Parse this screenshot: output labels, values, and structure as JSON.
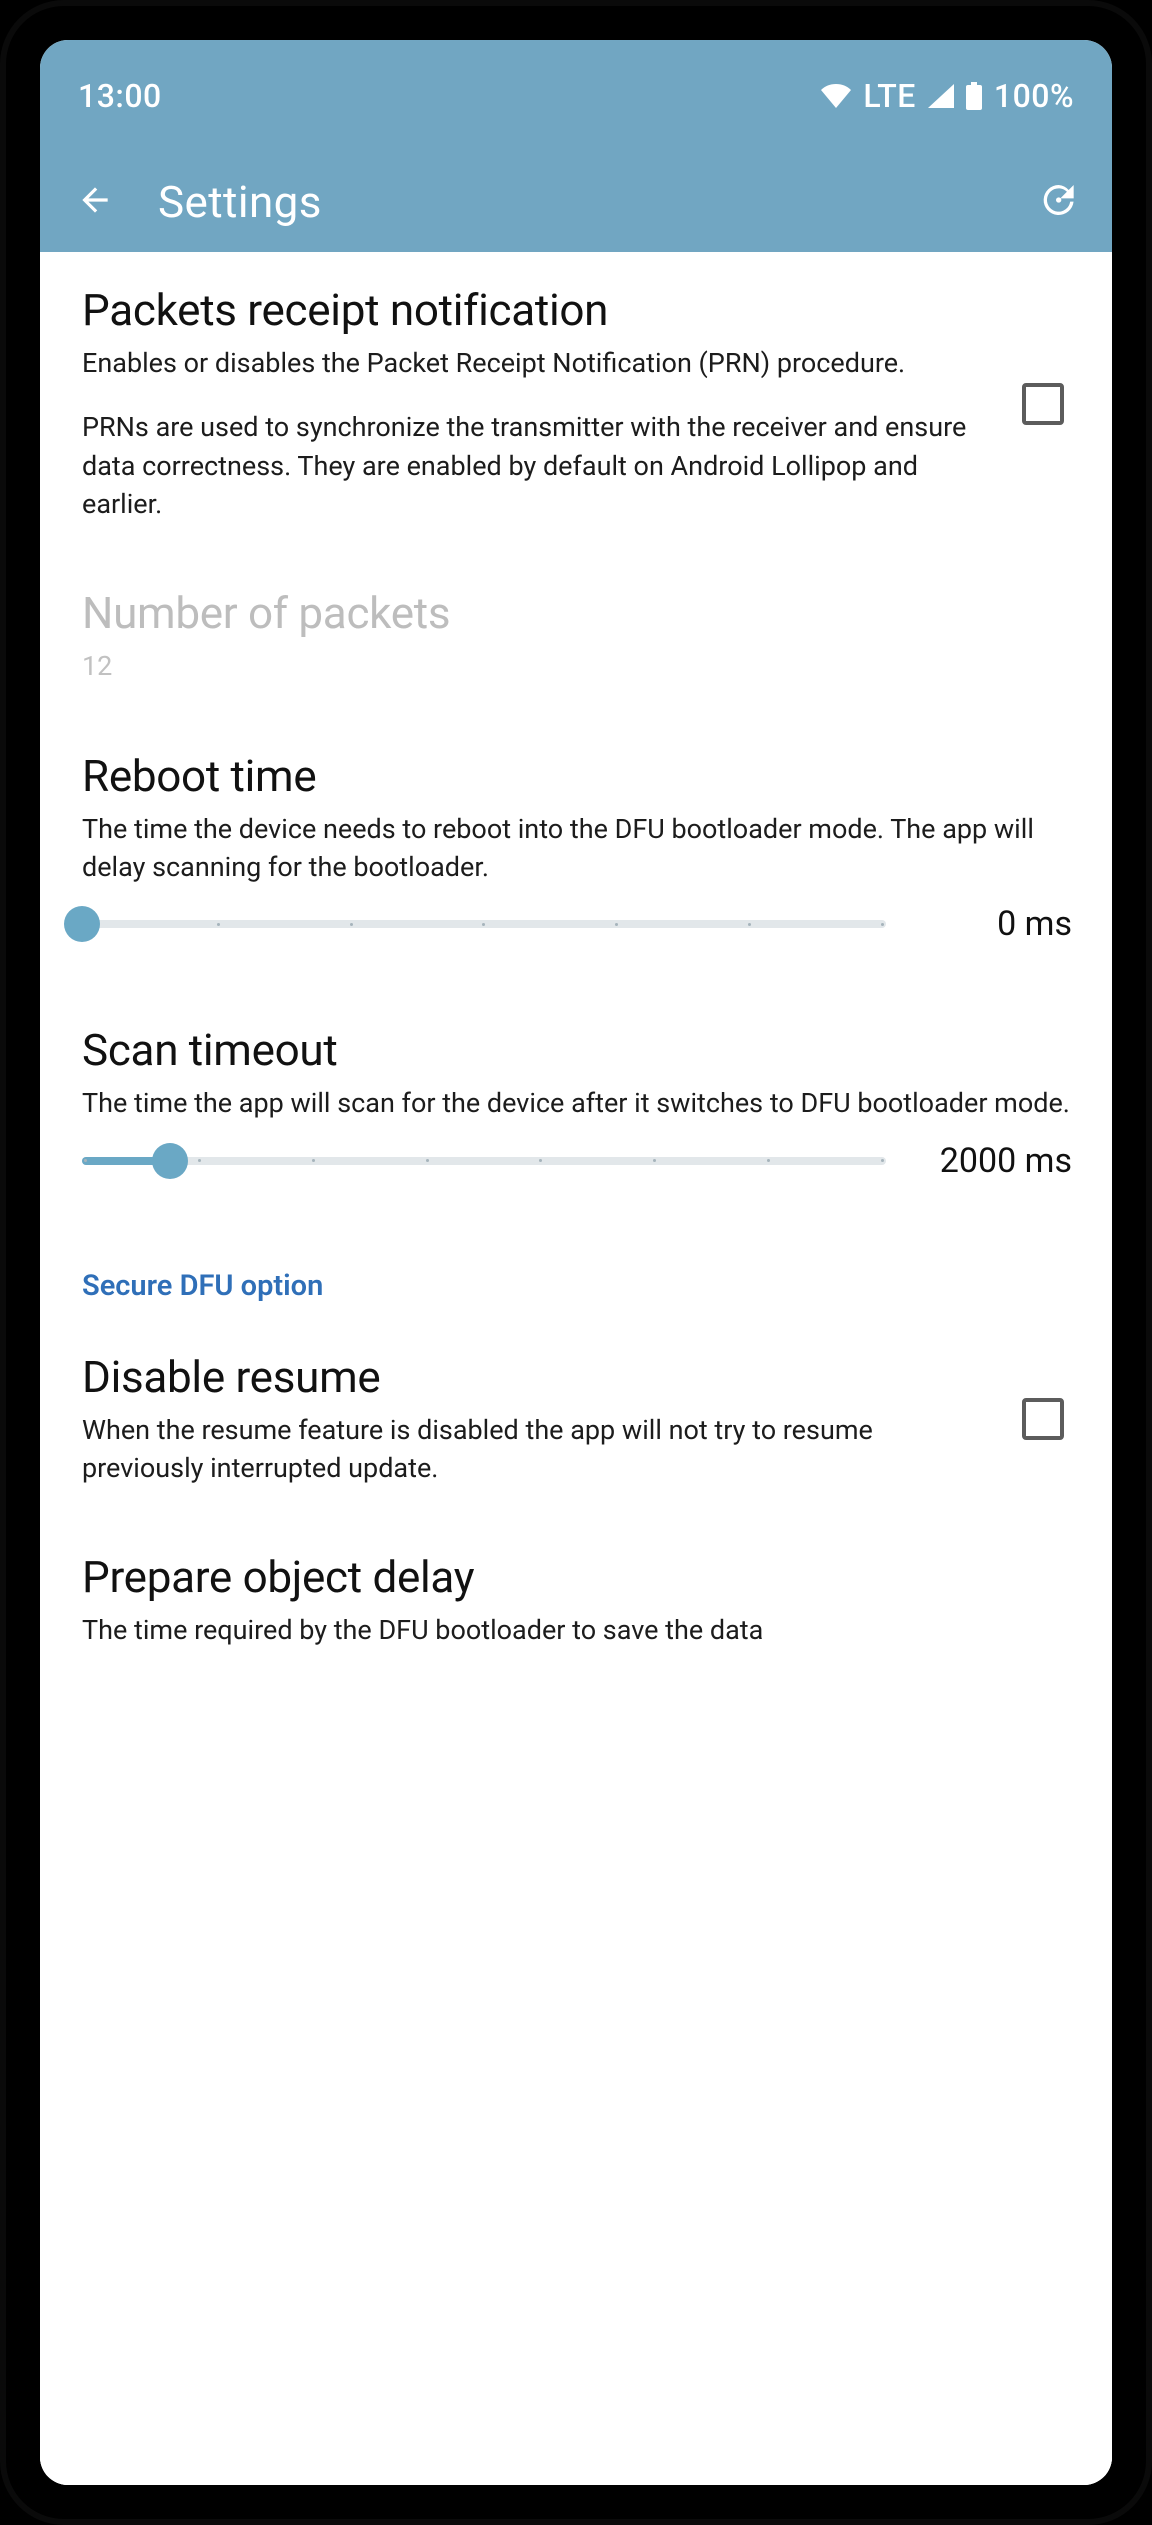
{
  "status": {
    "time": "13:00",
    "network": "LTE",
    "battery": "100%"
  },
  "appbar": {
    "title": "Settings"
  },
  "settings": {
    "prn": {
      "title": "Packets receipt notification",
      "desc1": "Enables or disables the Packet Receipt Notification (PRN) procedure.",
      "desc2": "PRNs are used to synchronize the transmitter with the receiver and ensure data correctness. They are enabled by default on Android Lollipop and earlier.",
      "checked": false
    },
    "packets": {
      "title": "Number of packets",
      "value": "12",
      "enabled": false
    },
    "reboot": {
      "title": "Reboot time",
      "desc": "The time the device needs to reboot into the DFU bootloader mode. The app will delay scanning for the bootloader.",
      "value_label": "0 ms",
      "percent": 0
    },
    "scan": {
      "title": "Scan timeout",
      "desc": "The time the app will scan for the device after it switches to DFU bootloader mode.",
      "value_label": "2000 ms",
      "percent": 11
    },
    "section": "Secure DFU option",
    "resume": {
      "title": "Disable resume",
      "desc": "When the resume feature is disabled the app will not try to resume previously interrupted update.",
      "checked": false
    },
    "prepare": {
      "title": "Prepare object delay",
      "desc": "The time required by the DFU bootloader to save the data"
    }
  }
}
